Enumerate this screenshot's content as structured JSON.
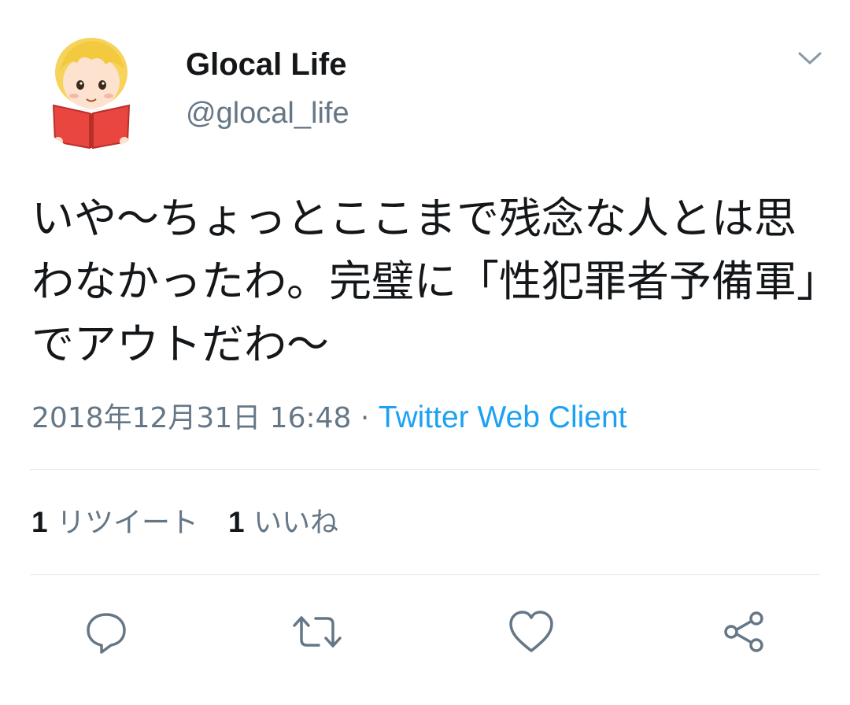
{
  "tweet": {
    "author": {
      "display_name": "Glocal Life",
      "handle": "@glocal_life",
      "avatar_icon": "boy-reading-book-avatar"
    },
    "menu_icon": "chevron-down-icon",
    "text": "いや〜ちょっとここまで残念な人とは思わなかったわ。完璧に「性犯罪者予備軍」でアウトだわ〜",
    "timestamp": "2018年12月31日 16:48",
    "separator": "·",
    "source": "Twitter Web Client",
    "stats": {
      "retweet_count": "1",
      "retweet_label": "リツイート",
      "like_count": "1",
      "like_label": "いいね"
    },
    "actions": [
      {
        "name": "reply",
        "icon": "reply-icon"
      },
      {
        "name": "retweet",
        "icon": "retweet-icon"
      },
      {
        "name": "like",
        "icon": "heart-icon"
      },
      {
        "name": "share",
        "icon": "share-icon"
      }
    ]
  },
  "colors": {
    "text_primary": "#14171a",
    "text_secondary": "#657786",
    "link": "#1da1f2",
    "divider": "#e1e8ed"
  }
}
